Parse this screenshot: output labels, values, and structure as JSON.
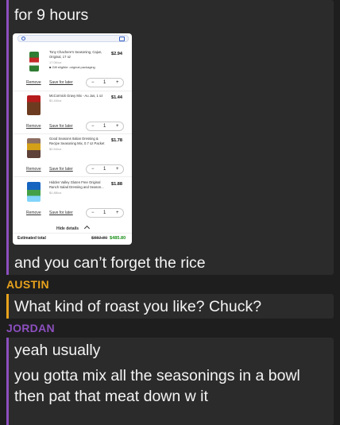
{
  "colors": {
    "austin": "#e8a21c",
    "jordan": "#8c4fbf",
    "background": "#1e1e1e",
    "message_bg": "#2b2b2b"
  },
  "chat": {
    "top_message_line2": "for 9 hours",
    "rice_message": "and you can’t forget the rice",
    "austin_label": "AUSTIN",
    "austin_message": "What kind of roast you like? Chuck?",
    "jordan_label": "JORDAN",
    "jordan_msg1": "yeah usually",
    "jordan_msg2_line1": "you gotta mix all the seasonings in a bowl",
    "jordan_msg2_line2": "then pat that meat down w it"
  },
  "screenshot": {
    "items": [
      {
        "name": "Tony Chachere's Seasoning, Cajun, Original, 17 oz",
        "sub": "17.0¢/oz",
        "gift": "Gift eligible: original packaging",
        "price": "$2.94",
        "remove": "Remove",
        "save": "Save for later",
        "qty": "1",
        "minus": "−",
        "plus": "+"
      },
      {
        "name": "McCormick Gravy Mix - Au Jus, 1 oz",
        "sub": "$1.44/oz",
        "price": "$1.44",
        "remove": "Remove",
        "save": "Save for later",
        "qty": "1",
        "minus": "−",
        "plus": "+"
      },
      {
        "name": "Good Seasons Italian Dressing & Recipe Seasoning Mix, 0.7 oz Packet",
        "sub": "$2.54/oz",
        "price": "$1.78",
        "remove": "Remove",
        "save": "Save for later",
        "qty": "1",
        "minus": "−",
        "plus": "+"
      },
      {
        "name": "Hidden Valley Gluten Free Original Ranch Salad Dressing and Season...",
        "sub": "$1.88/oz",
        "price": "$1.88",
        "remove": "Remove",
        "save": "Save for later",
        "qty": "1",
        "minus": "−",
        "plus": "+"
      }
    ],
    "hide_details": "Hide details",
    "estimated_total_label": "Estimated total",
    "old_total": "$882.80",
    "new_total": "$485.80"
  }
}
